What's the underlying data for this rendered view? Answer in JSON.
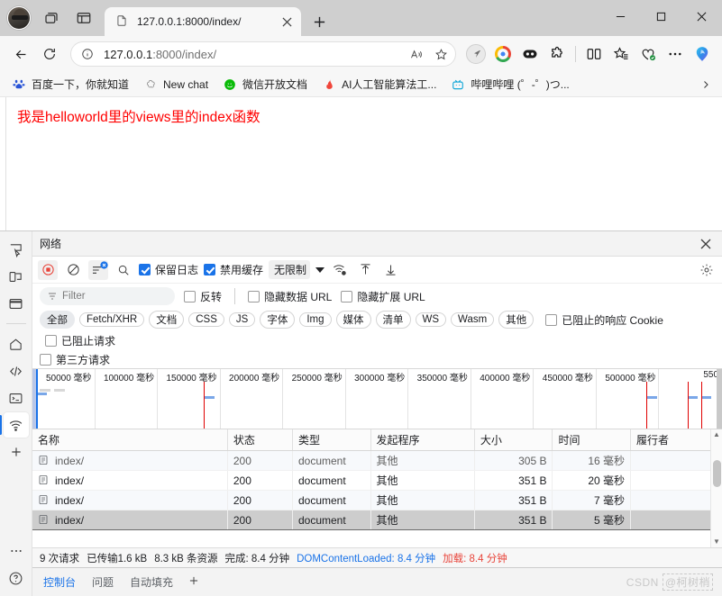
{
  "browser": {
    "tab": {
      "title": "127.0.0.1:8000/index/",
      "favicon": "document-icon",
      "close": "×"
    },
    "new_tab_label": "+",
    "window_controls": {
      "minimize": "—",
      "maximize": "▢",
      "close": "✕"
    },
    "nav": {
      "back": "←",
      "reload": "↻"
    },
    "omnibox": {
      "info_icon": "info-icon",
      "url_host": "127.0.0.1",
      "url_rest": ":8000/index/",
      "read_aloud": "A",
      "favorite": "☆"
    },
    "toolbar_icons": [
      "split-screen-icon",
      "favorites-icon",
      "browser-essentials-icon",
      "settings-more-icon",
      "copilot-icon"
    ],
    "bookmarks": [
      {
        "label": "百度一下，你就知道",
        "icon": "baidu-icon"
      },
      {
        "label": "New chat",
        "icon": "openai-icon"
      },
      {
        "label": "微信开放文档",
        "icon": "wechat-icon"
      },
      {
        "label": "AI人工智能算法工...",
        "icon": "flame-icon"
      },
      {
        "label": "哔哩哔哩 (゜-゜)つ...",
        "icon": "bilibili-icon"
      }
    ],
    "bookmarks_overflow": "›"
  },
  "page": {
    "body_text": "我是helloworld里的views里的index函数",
    "text_color": "#ff0000"
  },
  "devtools": {
    "activity_bar": [
      "inspect-element-icon",
      "device-toolbar-icon",
      "dock-panel-icon",
      "home-icon",
      "elements-code-icon",
      "console-terminal-icon",
      "network-icon",
      "add-tool-icon",
      "more-tools-icon",
      "help-icon"
    ],
    "panel_title": "网络",
    "close_label": "✕",
    "toolbar": {
      "record": "record-stop-icon",
      "clear": "clear-icon",
      "filter_toggle": "filter-icon",
      "search": "search-icon",
      "preserve_log": "保留日志",
      "preserve_log_checked": true,
      "disable_cache": "禁用缓存",
      "disable_cache_checked": true,
      "throttling": "无限制",
      "network_conditions": "network-conditions-icon",
      "import_har": "import-har-icon",
      "export_har": "export-har-icon",
      "settings": "settings-gear-icon"
    },
    "filter": {
      "placeholder": "Filter",
      "invert": "反转",
      "invert_checked": false,
      "hide_data_urls": "隐藏数据 URL",
      "hide_data_urls_checked": false,
      "hide_extension_urls": "隐藏扩展 URL",
      "hide_extension_urls_checked": false
    },
    "type_chips": [
      "全部",
      "Fetch/XHR",
      "文档",
      "CSS",
      "JS",
      "字体",
      "Img",
      "媒体",
      "清单",
      "WS",
      "Wasm",
      "其他"
    ],
    "active_chip": "全部",
    "blocked_cookies": "已阻止的响应 Cookie",
    "blocked_cookies_checked": false,
    "blocked_requests": "已阻止请求",
    "blocked_requests_checked": false,
    "third_party": "第三方请求",
    "third_party_checked": false,
    "overview_ticks": [
      "50000 毫秒",
      "100000 毫秒",
      "150000 毫秒",
      "200000 毫秒",
      "250000 毫秒",
      "300000 毫秒",
      "350000 毫秒",
      "400000 毫秒",
      "450000 毫秒",
      "500000 毫秒",
      "550"
    ],
    "table": {
      "columns": [
        "名称",
        "状态",
        "类型",
        "发起程序",
        "大小",
        "时间",
        "履行者"
      ],
      "rows": [
        {
          "name": "index/",
          "status": "200",
          "type": "document",
          "initiator": "其他",
          "size": "305 B",
          "time": "16 毫秒",
          "waterfall": "",
          "clipped": true
        },
        {
          "name": "index/",
          "status": "200",
          "type": "document",
          "initiator": "其他",
          "size": "351 B",
          "time": "20 毫秒",
          "waterfall": ""
        },
        {
          "name": "index/",
          "status": "200",
          "type": "document",
          "initiator": "其他",
          "size": "351 B",
          "time": "7 毫秒",
          "waterfall": ""
        },
        {
          "name": "index/",
          "status": "200",
          "type": "document",
          "initiator": "其他",
          "size": "351 B",
          "time": "5 毫秒",
          "waterfall": "",
          "selected": true
        }
      ]
    },
    "summary": {
      "requests": "9 次请求",
      "transferred": "已传输1.6 kB",
      "resources": "8.3 kB 条资源",
      "finish": "完成: 8.4 分钟",
      "dom_content_loaded": "DOMContentLoaded: 8.4 分钟",
      "load": "加载: 8.4 分钟"
    },
    "drawer_tabs": [
      "控制台",
      "问题",
      "自动填充"
    ],
    "drawer_active": "控制台",
    "drawer_add": "+"
  },
  "watermark": {
    "text": "CSDN",
    "suffix": "@柯树梢"
  }
}
